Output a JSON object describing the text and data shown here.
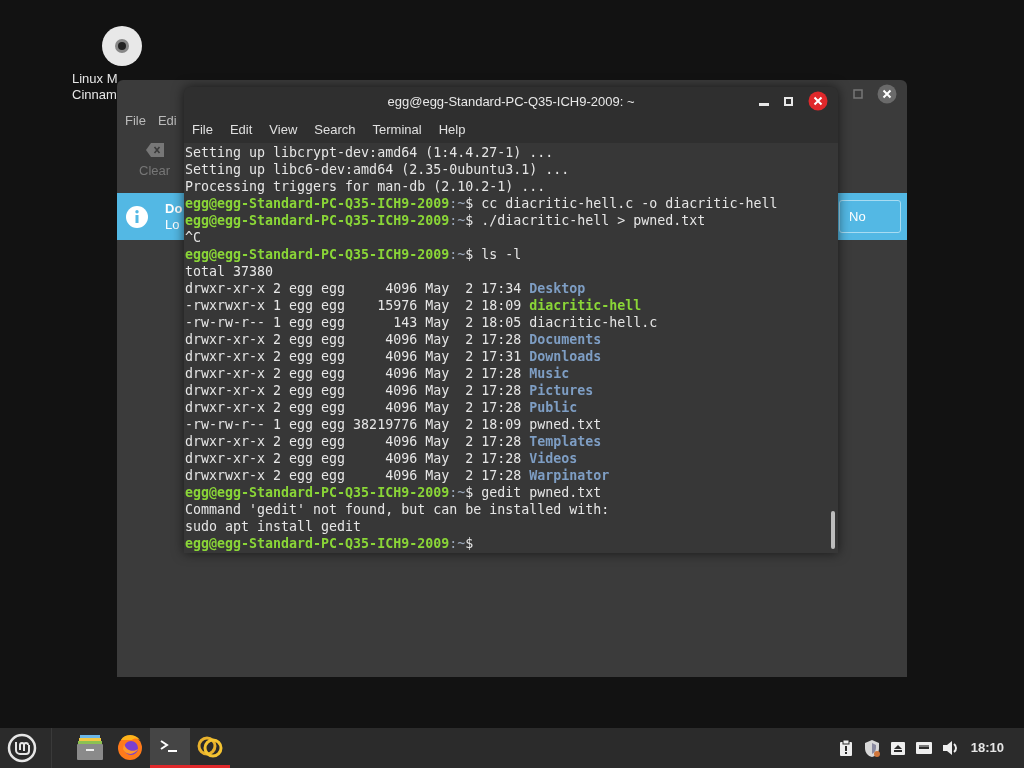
{
  "desktop_icons": [
    {
      "label_lines": [
        "Linux M",
        "Cinnam"
      ]
    }
  ],
  "back_window": {
    "menu": [
      "File",
      "Edi"
    ],
    "toolbar": [
      {
        "label": "Clear"
      }
    ],
    "info_bar": {
      "title": "Do",
      "subtitle": "Lo",
      "button": "No"
    }
  },
  "terminal": {
    "title": "egg@egg-Standard-PC-Q35-ICH9-2009: ~",
    "menu": [
      "File",
      "Edit",
      "View",
      "Search",
      "Terminal",
      "Help"
    ],
    "lines": [
      {
        "segments": [
          {
            "kind": "plain",
            "text": "Setting up libcrypt-dev:amd64 (1:4.4.27-1) ..."
          }
        ]
      },
      {
        "segments": [
          {
            "kind": "plain",
            "text": "Setting up libc6-dev:amd64 (2.35-0ubuntu3.1) ..."
          }
        ]
      },
      {
        "segments": [
          {
            "kind": "plain",
            "text": "Processing triggers for man-db (2.10.2-1) ..."
          }
        ]
      },
      {
        "segments": [
          {
            "kind": "prompt",
            "text": "egg@egg-Standard-PC-Q35-ICH9-2009"
          },
          {
            "kind": "path",
            "text": ":~"
          },
          {
            "kind": "plain",
            "text": "$ cc diacritic-hell.c -o diacritic-hell"
          }
        ]
      },
      {
        "segments": [
          {
            "kind": "prompt",
            "text": "egg@egg-Standard-PC-Q35-ICH9-2009"
          },
          {
            "kind": "path",
            "text": ":~"
          },
          {
            "kind": "plain",
            "text": "$ ./diacritic-hell > pwned.txt"
          }
        ]
      },
      {
        "segments": [
          {
            "kind": "plain",
            "text": "^C"
          }
        ]
      },
      {
        "segments": [
          {
            "kind": "prompt",
            "text": "egg@egg-Standard-PC-Q35-ICH9-2009"
          },
          {
            "kind": "path",
            "text": ":~"
          },
          {
            "kind": "plain",
            "text": "$ ls -l"
          }
        ]
      },
      {
        "segments": [
          {
            "kind": "plain",
            "text": "total 37380"
          }
        ]
      },
      {
        "segments": [
          {
            "kind": "plain",
            "text": "drwxr-xr-x 2 egg egg     4096 May  2 17:34 "
          },
          {
            "kind": "dir",
            "text": "Desktop"
          }
        ]
      },
      {
        "segments": [
          {
            "kind": "plain",
            "text": "-rwxrwxr-x 1 egg egg    15976 May  2 18:09 "
          },
          {
            "kind": "exec",
            "text": "diacritic-hell"
          }
        ]
      },
      {
        "segments": [
          {
            "kind": "plain",
            "text": "-rw-rw-r-- 1 egg egg      143 May  2 18:05 diacritic-hell.c"
          }
        ]
      },
      {
        "segments": [
          {
            "kind": "plain",
            "text": "drwxr-xr-x 2 egg egg     4096 May  2 17:28 "
          },
          {
            "kind": "dir",
            "text": "Documents"
          }
        ]
      },
      {
        "segments": [
          {
            "kind": "plain",
            "text": "drwxr-xr-x 2 egg egg     4096 May  2 17:31 "
          },
          {
            "kind": "dir",
            "text": "Downloads"
          }
        ]
      },
      {
        "segments": [
          {
            "kind": "plain",
            "text": "drwxr-xr-x 2 egg egg     4096 May  2 17:28 "
          },
          {
            "kind": "dir",
            "text": "Music"
          }
        ]
      },
      {
        "segments": [
          {
            "kind": "plain",
            "text": "drwxr-xr-x 2 egg egg     4096 May  2 17:28 "
          },
          {
            "kind": "dir",
            "text": "Pictures"
          }
        ]
      },
      {
        "segments": [
          {
            "kind": "plain",
            "text": "drwxr-xr-x 2 egg egg     4096 May  2 17:28 "
          },
          {
            "kind": "dir",
            "text": "Public"
          }
        ]
      },
      {
        "segments": [
          {
            "kind": "plain",
            "text": "-rw-rw-r-- 1 egg egg 38219776 May  2 18:09 pwned.txt"
          }
        ]
      },
      {
        "segments": [
          {
            "kind": "plain",
            "text": "drwxr-xr-x 2 egg egg     4096 May  2 17:28 "
          },
          {
            "kind": "dir",
            "text": "Templates"
          }
        ]
      },
      {
        "segments": [
          {
            "kind": "plain",
            "text": "drwxr-xr-x 2 egg egg     4096 May  2 17:28 "
          },
          {
            "kind": "dir",
            "text": "Videos"
          }
        ]
      },
      {
        "segments": [
          {
            "kind": "plain",
            "text": "drwxrwxr-x 2 egg egg     4096 May  2 17:28 "
          },
          {
            "kind": "dir",
            "text": "Warpinator"
          }
        ]
      },
      {
        "segments": [
          {
            "kind": "prompt",
            "text": "egg@egg-Standard-PC-Q35-ICH9-2009"
          },
          {
            "kind": "path",
            "text": ":~"
          },
          {
            "kind": "plain",
            "text": "$ gedit pwned.txt"
          }
        ]
      },
      {
        "segments": [
          {
            "kind": "plain",
            "text": "Command 'gedit' not found, but can be installed with:"
          }
        ]
      },
      {
        "segments": [
          {
            "kind": "plain",
            "text": "sudo apt install gedit"
          }
        ]
      },
      {
        "segments": [
          {
            "kind": "prompt",
            "text": "egg@egg-Standard-PC-Q35-ICH9-2009"
          },
          {
            "kind": "path",
            "text": ":~"
          },
          {
            "kind": "plain",
            "text": "$"
          }
        ]
      }
    ]
  },
  "taskbar": {
    "launchers": [
      {
        "kind": "files",
        "running": false,
        "active": false
      },
      {
        "kind": "firefox",
        "running": false,
        "active": false
      },
      {
        "kind": "terminal",
        "running": true,
        "active": true
      },
      {
        "kind": "sync",
        "running": true,
        "active": false
      }
    ],
    "tray": [
      {
        "kind": "clipboard"
      },
      {
        "kind": "shield"
      },
      {
        "kind": "eject"
      },
      {
        "kind": "network"
      },
      {
        "kind": "volume"
      }
    ],
    "clock": "18:10"
  }
}
